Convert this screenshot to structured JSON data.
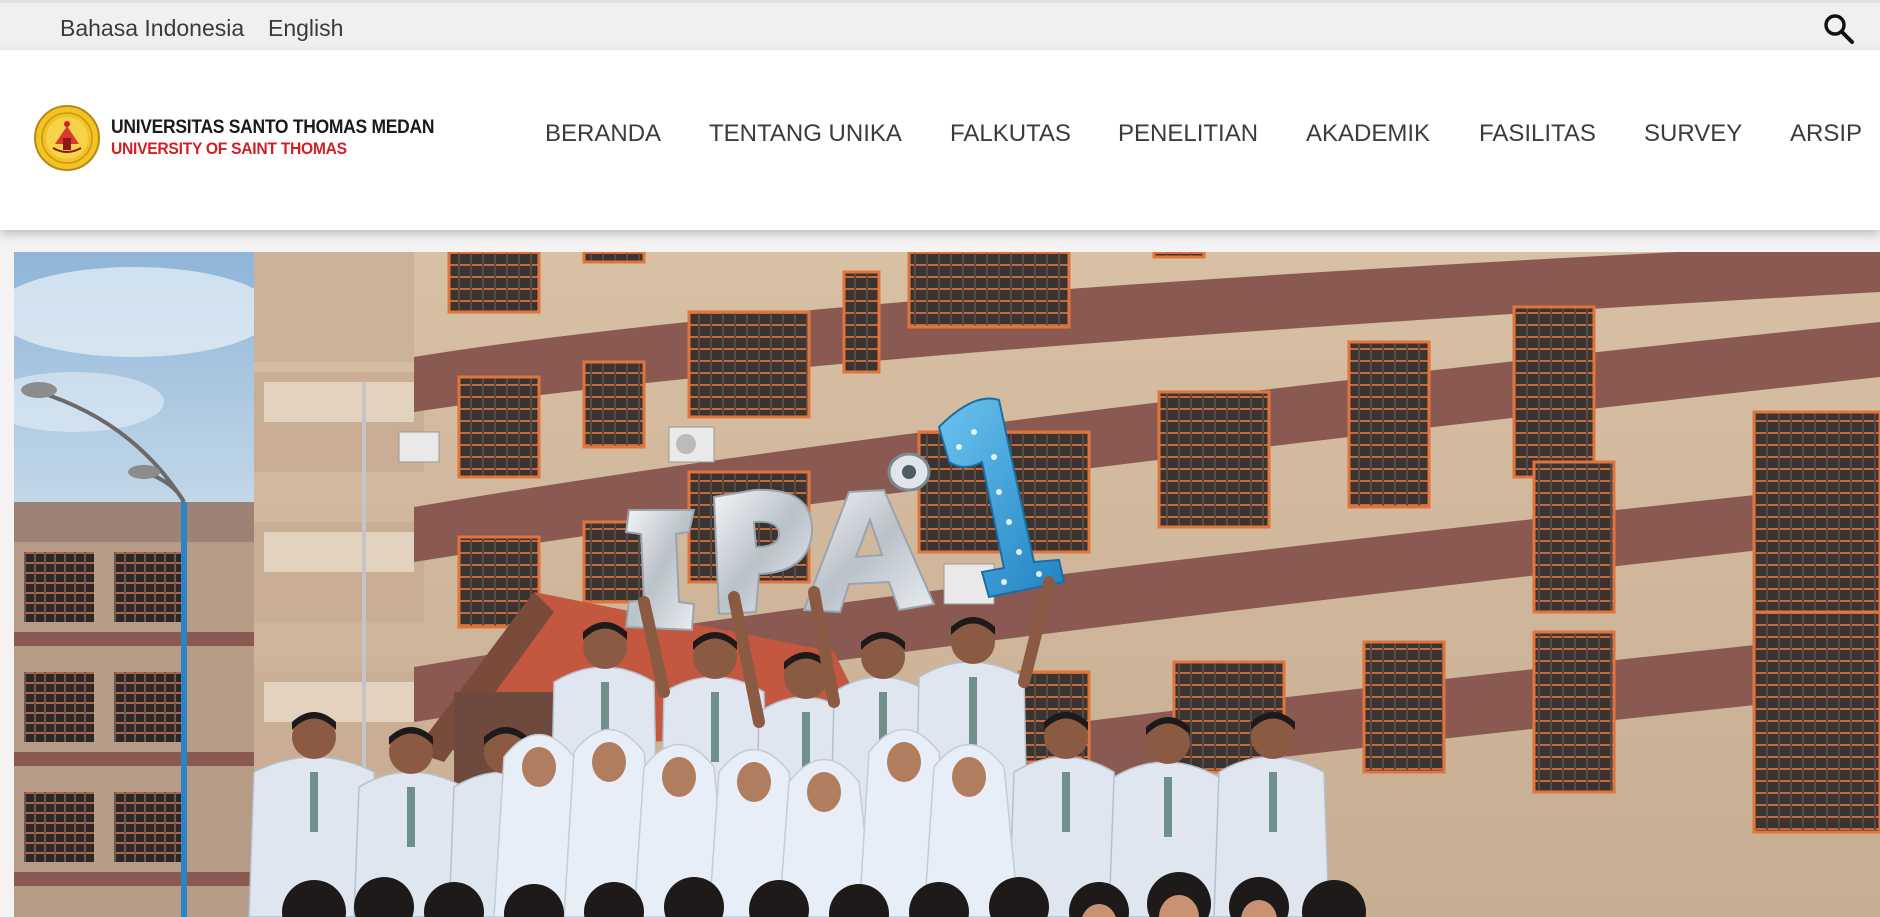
{
  "topbar": {
    "languages": [
      "Bahasa Indonesia",
      "English"
    ],
    "search_icon": "search-icon"
  },
  "brand": {
    "name": "UNIVERSITAS SANTO THOMAS MEDAN",
    "subtitle": "UNIVERSITY OF SAINT THOMAS",
    "logo_icon": "university-crest-logo"
  },
  "nav": {
    "items": [
      "BERANDA",
      "TENTANG UNIKA",
      "FALKUTAS",
      "PENELITIAN",
      "AKADEMIK",
      "FASILITAS",
      "SURVEY",
      "ARSIP"
    ]
  },
  "hero": {
    "balloon_letters": [
      "I",
      "P",
      "A",
      "1"
    ],
    "colors": {
      "sky": "#a9c6e0",
      "building": "#d3b99c",
      "trim": "#8a5a52",
      "window_frame": "#e0743a",
      "balloon_silver": "#d8dde3",
      "balloon_blue": "#2e9ad6",
      "uniform_shirt": "#dfe6f0",
      "tie": "#6f8f8a",
      "hijab": "#e8eef7"
    }
  },
  "colors": {
    "topbar_bg": "#f0f0f0",
    "nav_bg": "#ffffff",
    "nav_text": "#3c3c3c",
    "brand_red": "#d21f26",
    "brand_dark": "#1a1a1a",
    "logo_gold": "#f2c322"
  }
}
